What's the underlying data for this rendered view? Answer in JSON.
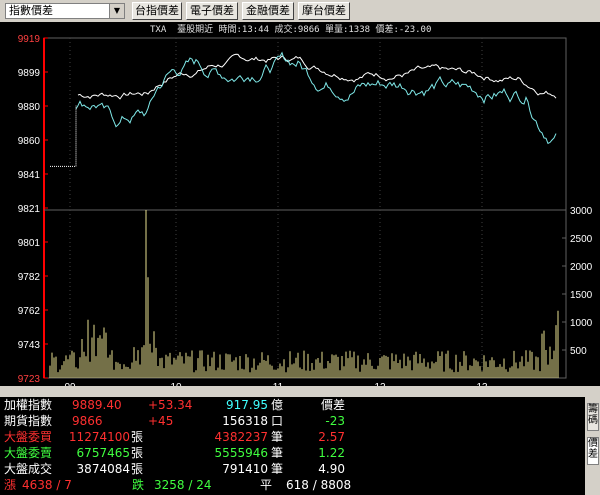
{
  "toolbar": {
    "select_value": "指數價差",
    "buttons": [
      "台指價差",
      "電子價差",
      "金融價差",
      "摩台價差"
    ]
  },
  "chart": {
    "info": "TXA  臺股期近 時間:13:44 成交:9866 單量:1338 價差:-23.00",
    "left_ticks": [
      "9919",
      "9899",
      "9880",
      "9860",
      "9841",
      "9821",
      "9801",
      "9782",
      "9762",
      "9743",
      "9723"
    ],
    "right_ticks": [
      "3000",
      "2500",
      "2000",
      "1500",
      "1000",
      "500"
    ],
    "x_ticks": [
      "09",
      "10",
      "11",
      "12",
      "13"
    ],
    "colors": {
      "index": "#ffffff",
      "futures": "#7fe8e8",
      "volume": "#e8e090",
      "axis": "#ff0000",
      "grid": "#404040"
    }
  },
  "panel": {
    "rows": [
      {
        "label": "加權指數",
        "v1": "9889.40",
        "v2": "+53.34",
        "v3": "917.95",
        "u3": "億",
        "v4": "價差"
      },
      {
        "label": "期貨指數",
        "v1": "9866",
        "v2": "+45",
        "v3": "156318",
        "u3": "口",
        "v4": "-23"
      },
      {
        "label": "大盤委買",
        "v1": "11274100",
        "u1": "張",
        "v3": "4382237",
        "u3": "筆",
        "v4": "2.57"
      },
      {
        "label": "大盤委賣",
        "v1": "6757465",
        "u1": "張",
        "v3": "5555946",
        "u3": "筆",
        "v4": "1.22"
      },
      {
        "label": "大盤成交",
        "v1": "3874084",
        "u1": "張",
        "v3": "791410",
        "u3": "筆",
        "v4": "4.90"
      }
    ],
    "bottom": {
      "up_label": "漲",
      "up": "4638 / 7",
      "down_label": "跌",
      "down": "3258 / 24",
      "flat_label": "平",
      "flat": "618 / 8808"
    }
  },
  "side_tabs": [
    "籌碼",
    "價差"
  ]
}
